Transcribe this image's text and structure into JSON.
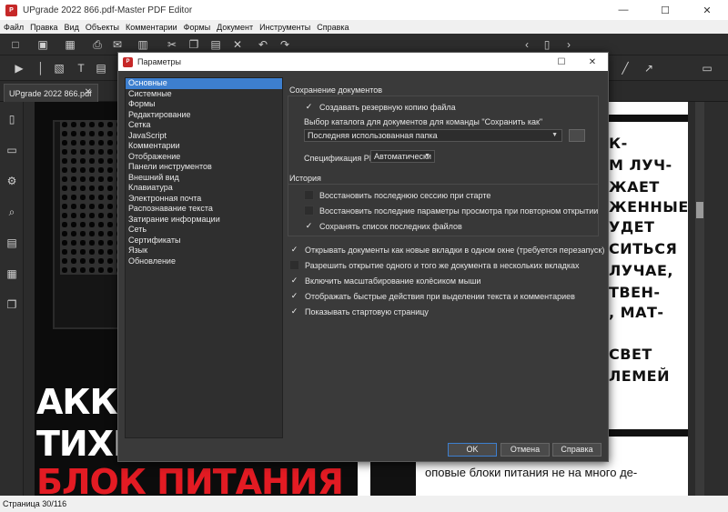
{
  "window": {
    "title": "UPgrade 2022 866.pdf-Master PDF Editor"
  },
  "menu": [
    "Файл",
    "Правка",
    "Вид",
    "Объекты",
    "Комментарии",
    "Формы",
    "Документ",
    "Инструменты",
    "Справка"
  ],
  "doc_tab": {
    "label": "UPgrade 2022 866.pdf"
  },
  "page_content": {
    "big_lines": [
      "АККУ",
      "ТИХИ",
      "БЛОК ПИТАНИЯ"
    ],
    "right_lines": [
      "К-",
      "М ЛУЧ-",
      "ЖАЕТ",
      "ЖЕННЫЕ",
      "УДЕТ",
      "СИТЬСЯ",
      "ЛУЧАЕ,",
      "ТВЕН-",
      ", МАТ-",
      "СВЕТ",
      "ЛЕМЕЙ"
    ],
    "body_line": "оповые блоки питания не на много де-"
  },
  "status": {
    "page": "Страница 30/116"
  },
  "dialog": {
    "title": "Параметры",
    "categories": [
      "Основные",
      "Системные",
      "Формы",
      "Редактирование",
      "Сетка",
      "JavaScript",
      "Комментарии",
      "Отображение",
      "Панели инструментов",
      "Внешний вид",
      "Клавиатура",
      "Электронная почта",
      "Распознавание текста",
      "Затирание информации",
      "Сеть",
      "Сертификаты",
      "Язык",
      "Обновление"
    ],
    "selected_category": "Основные",
    "save_section": {
      "header": "Сохранение документов",
      "backup_label": "Создавать резервную копию файла",
      "folder_label": "Выбор каталога для документов для команды \"Сохранить как\"",
      "folder_value": "Последняя использованная папка",
      "pdf_spec_label": "Спецификация PDF",
      "pdf_spec_value": "Автоматически"
    },
    "history_section": {
      "header": "История",
      "restore_session": "Восстановить последнюю сессию при старте",
      "restore_view": "Восстановить последние параметры просмотра при повторном открытии",
      "save_recent": "Сохранять список последних файлов"
    },
    "options": {
      "new_tabs": "Открывать документы как новые вкладки в одном окне (требуется перезапуск)",
      "multi_open": "Разрешить открытие одного и того же документа в нескольких вкладках",
      "wheel_zoom": "Включить масштабирование колёсиком мыши",
      "quick_actions": "Отображать быстрые действия при выделении текста и комментариев",
      "start_page": "Показывать стартовую страницу"
    },
    "buttons": {
      "ok": "OK",
      "cancel": "Отмена",
      "help": "Справка"
    }
  },
  "colors": {
    "accent": "#3d7fcf",
    "brand_red": "#c62828",
    "headline_red": "#e31b23"
  }
}
